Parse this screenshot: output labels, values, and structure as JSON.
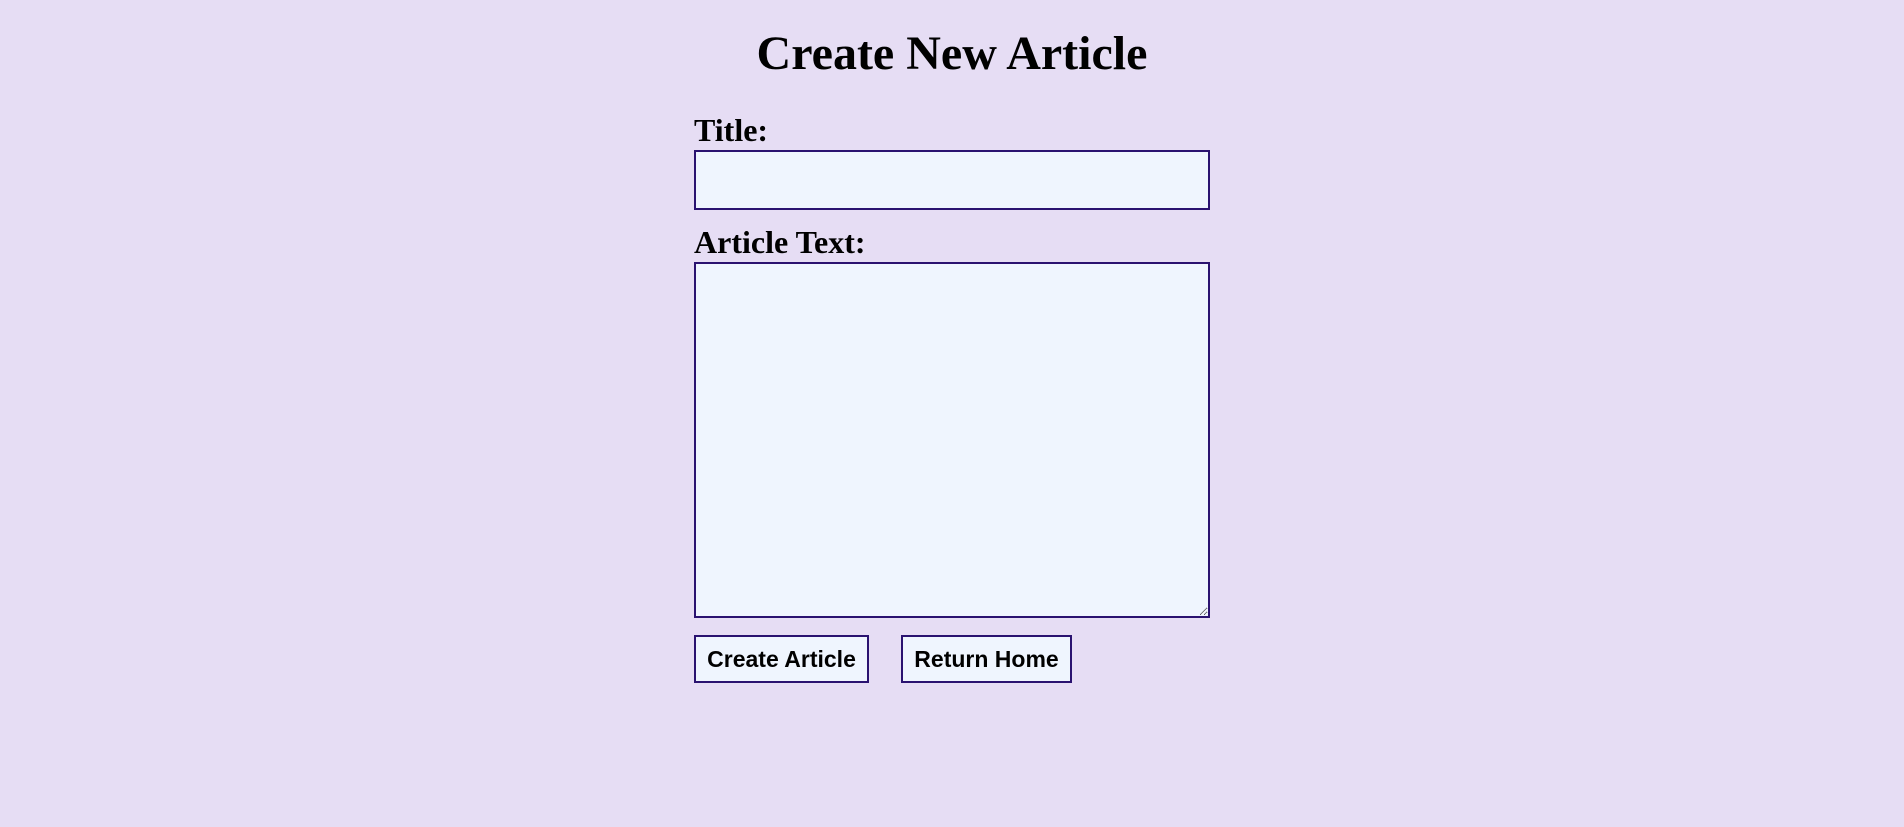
{
  "page": {
    "title": "Create New Article"
  },
  "form": {
    "title_label": "Title:",
    "title_value": "",
    "title_placeholder": "",
    "text_label": "Article Text:",
    "text_value": "",
    "text_placeholder": ""
  },
  "actions": {
    "create_label": "Create Article",
    "home_label": "Return Home"
  },
  "colors": {
    "background": "#e6ddf4",
    "field_background": "#eff5fe",
    "border": "#2a1270"
  }
}
